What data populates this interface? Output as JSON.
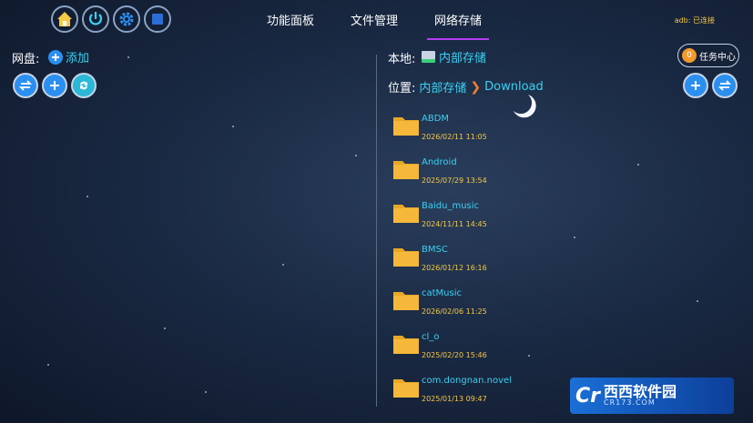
{
  "tabs": [
    {
      "label": "功能面板"
    },
    {
      "label": "文件管理"
    },
    {
      "label": "网络存储",
      "active": true
    }
  ],
  "status": {
    "adb": "adb: 已连接"
  },
  "left": {
    "label": "网盘:",
    "add_label": "添加"
  },
  "right": {
    "local_label": "本地:",
    "drive_name": "内部存储",
    "task_count": "0",
    "task_label": "任务中心",
    "path_label": "位置:",
    "path": [
      "内部存储",
      "Download"
    ]
  },
  "files": [
    {
      "name": "ABDM",
      "date": "2026/02/11 11:05"
    },
    {
      "name": "Android",
      "date": "2025/07/29 13:54"
    },
    {
      "name": "Baidu_music",
      "date": "2024/11/11 14:45"
    },
    {
      "name": "BMSC",
      "date": "2026/01/12 16:16"
    },
    {
      "name": "catMusic",
      "date": "2026/02/06 11:25"
    },
    {
      "name": "cl_o",
      "date": "2025/02/20 15:46"
    },
    {
      "name": "com.dongnan.novel",
      "date": "2025/01/13 09:47"
    }
  ],
  "watermark": {
    "brand": "西西软件园",
    "site": "CR173.COM"
  },
  "colors": {
    "accent": "#3ad1f2",
    "tab_indicator": "#b23ef2",
    "folder": "#f6b83a",
    "date": "#f6c945"
  }
}
